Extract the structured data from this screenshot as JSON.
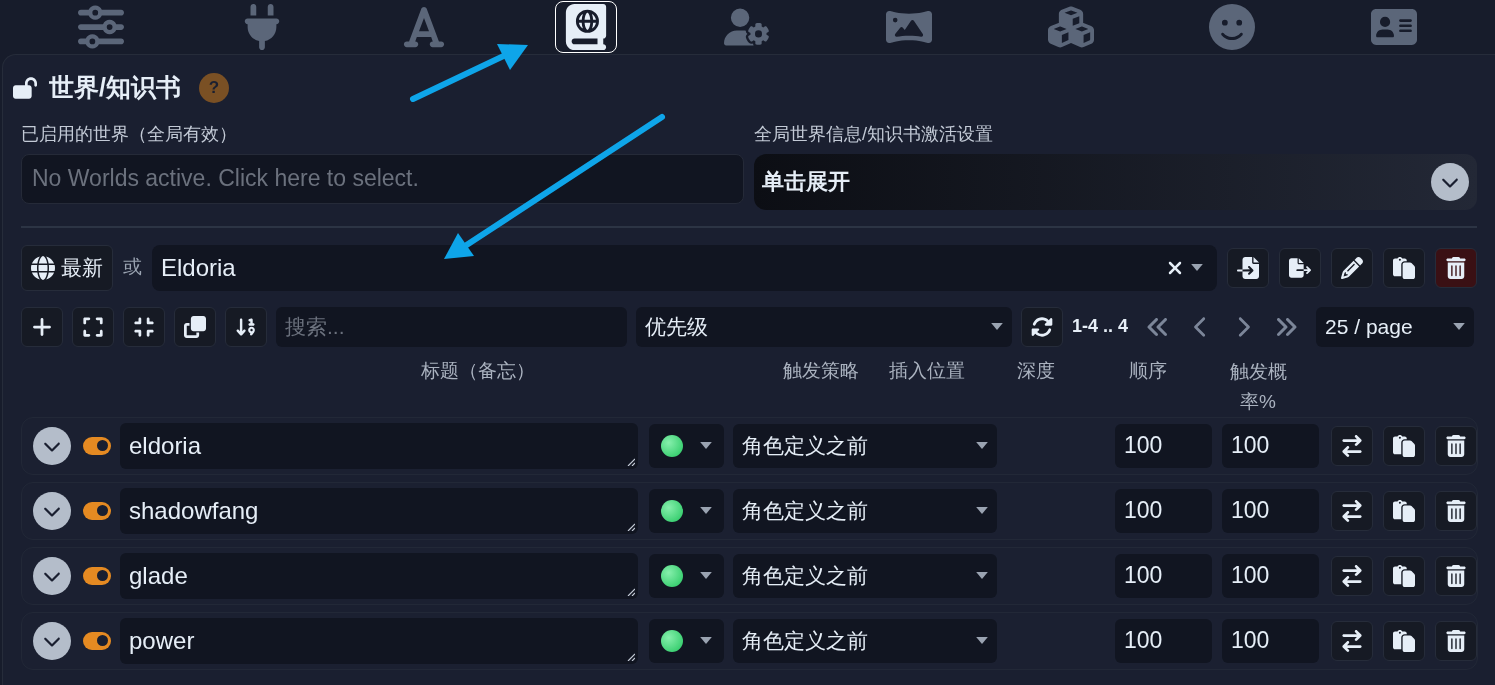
{
  "tabs": [
    {
      "selected": false
    },
    {
      "selected": false
    },
    {
      "selected": false
    },
    {
      "selected": true
    },
    {
      "selected": false
    },
    {
      "selected": false
    },
    {
      "selected": false
    },
    {
      "selected": false
    },
    {
      "selected": false
    }
  ],
  "panel": {
    "title": "世界/知识书",
    "help": "?"
  },
  "active_worlds": {
    "label": "已启用的世界（全局有效）",
    "placeholder": "No Worlds active. Click here to select."
  },
  "activation_settings": {
    "label": "全局世界信息/知识书激活设置",
    "button": "单击展开"
  },
  "world_select": {
    "new_button": "最新",
    "or": "或",
    "value": "Eldoria"
  },
  "toolbar": {
    "search_placeholder": "搜索...",
    "sort": "优先级",
    "range": "1-4 .. 4",
    "page_size": "25 / page"
  },
  "columns": [
    "标题（备忘）",
    "触发策略",
    "插入位置",
    "深度",
    "顺序",
    "触发概率%"
  ],
  "entries": [
    {
      "title": "eldoria",
      "enabled": true,
      "position": "角色定义之前",
      "order": "100",
      "probability": "100"
    },
    {
      "title": "shadowfang",
      "enabled": true,
      "position": "角色定义之前",
      "order": "100",
      "probability": "100"
    },
    {
      "title": "glade",
      "enabled": true,
      "position": "角色定义之前",
      "order": "100",
      "probability": "100"
    },
    {
      "title": "power",
      "enabled": true,
      "position": "角色定义之前",
      "order": "100",
      "probability": "100"
    }
  ]
}
